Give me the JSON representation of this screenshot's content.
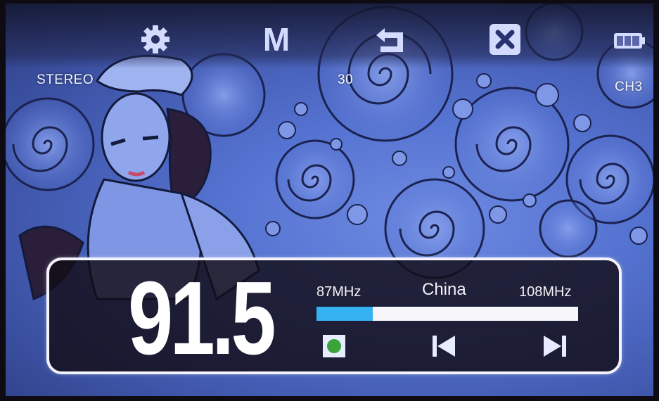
{
  "status": {
    "stereo": "STEREO",
    "volume": "30",
    "channel": "CH3"
  },
  "toolbar": {
    "icons": [
      "gear-icon",
      "mode-icon",
      "return-icon",
      "close-icon",
      "battery-icon"
    ],
    "mode_label": "M"
  },
  "radio": {
    "frequency": "91.5",
    "min_label": "87MHz",
    "max_label": "108MHz",
    "region": "China",
    "min_mhz": 87,
    "max_mhz": 108,
    "current_mhz": 91.5
  },
  "colors": {
    "tuner_fill": "#36b2f2",
    "record_dot": "#3aa33a"
  }
}
